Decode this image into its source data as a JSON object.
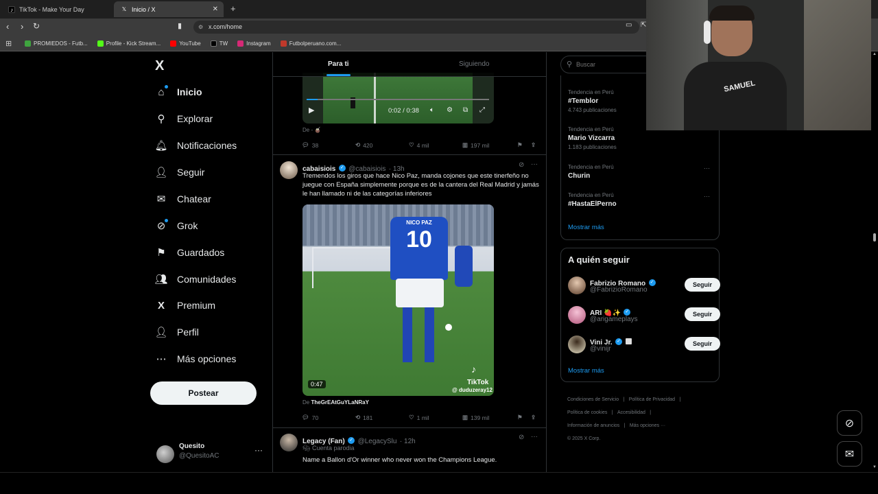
{
  "browser": {
    "tabs": [
      {
        "title": "TikTok - Make Your Day",
        "active": false
      },
      {
        "title": "Inicio / X",
        "active": true
      }
    ],
    "url": "x.com/home",
    "bookmarks": [
      {
        "label": "PROMIEDOS - Futb...",
        "color": "#3fa43f"
      },
      {
        "label": "Profile - Kick Stream...",
        "color": "#53fc18"
      },
      {
        "label": "YouTube",
        "color": "#ff0000"
      },
      {
        "label": "TW",
        "color": "#000000"
      },
      {
        "label": "Instagram",
        "color": "#d62976"
      },
      {
        "label": "Futbolperuano.com...",
        "color": "#c0392b"
      }
    ]
  },
  "sidebar": {
    "logo": "X",
    "items": [
      {
        "label": "Inicio",
        "icon": "home-icon"
      },
      {
        "label": "Explorar",
        "icon": "search-icon"
      },
      {
        "label": "Notificaciones",
        "icon": "bell-icon"
      },
      {
        "label": "Seguir",
        "icon": "add-user-icon"
      },
      {
        "label": "Chatear",
        "icon": "mail-icon"
      },
      {
        "label": "Grok",
        "icon": "grok-icon"
      },
      {
        "label": "Guardados",
        "icon": "bookmark-icon"
      },
      {
        "label": "Comunidades",
        "icon": "people-icon"
      },
      {
        "label": "Premium",
        "icon": "x-logo-icon"
      },
      {
        "label": "Perfil",
        "icon": "person-icon"
      },
      {
        "label": "Más opciones",
        "icon": "more-circle-icon"
      }
    ],
    "post_label": "Postear",
    "account": {
      "name": "Quesito",
      "handle": "@QuesitoAC"
    }
  },
  "timeline": {
    "tabs": [
      "Para ti",
      "Siguiendo"
    ],
    "post1": {
      "video_time": "0:02 / 0:38",
      "source": "De - 🧉",
      "replies": "38",
      "reposts": "420",
      "likes": "4 mil",
      "views": "197 mil"
    },
    "post2": {
      "name": "cabaisiois",
      "handle": "@cabaisiois",
      "time": "· 13h",
      "text": "Tremendos los giros que hace Nico Paz, manda cojones que este tinerfeño no juegue con España simplemente porque es de la cantera del Real Madrid y jamás le han llamado ni de las categorías inferiores",
      "video_duration": "0:47",
      "watermark": "TikTok",
      "watermark_handle": "@ duduzeray12",
      "jersey_name": "NICO PAZ",
      "jersey_number": "10",
      "source_prefix": "De",
      "source": "TheGrEAtGuYLaNRaY",
      "replies": "70",
      "reposts": "181",
      "likes": "1 mil",
      "views": "139 mil"
    },
    "post3": {
      "name": "Legacy (Fan)",
      "handle": "@LegacySlu",
      "time": "· 12h",
      "badge": "Cuenta parodia",
      "text": "Name a Ballon d'Or winner who never won the Champions League."
    }
  },
  "right": {
    "search_placeholder": "Buscar",
    "trends": [
      {
        "meta": "Tendencia en Perú",
        "name": "#Temblor",
        "count": "4.743 publicaciones"
      },
      {
        "meta": "Tendencia en Perú",
        "name": "Mario Vizcarra",
        "count": "1.183 publicaciones"
      },
      {
        "meta": "Tendencia en Perú",
        "name": "Churin",
        "count": ""
      },
      {
        "meta": "Tendencia en Perú",
        "name": "#HastaElPerno",
        "count": ""
      }
    ],
    "show_more": "Mostrar más",
    "who_to_follow_title": "A quién seguir",
    "follow_label": "Seguir",
    "suggestions": [
      {
        "name": "Fabrizio Romano",
        "handle": "@FabrizioRomano",
        "avatar_color": "#8a6a55"
      },
      {
        "name": "ARI 🍓✨",
        "handle": "@arigameplays",
        "avatar_color": "#d98aa8"
      },
      {
        "name": "Vini Jr.",
        "handle": "@vinijr",
        "avatar_color": "#ddd6b8"
      }
    ],
    "show_more_2": "Mostrar más",
    "footer": {
      "l1": "Condiciones de Servicio",
      "l2": "Política de Privacidad",
      "l3": "Política de cookies",
      "l4": "Accesibilidad",
      "l5": "Información de anuncios",
      "l6": "Más opciones ···",
      "l7": "© 2025 X Corp."
    }
  },
  "webcam": {
    "shirt_text": "SAMUEL"
  }
}
